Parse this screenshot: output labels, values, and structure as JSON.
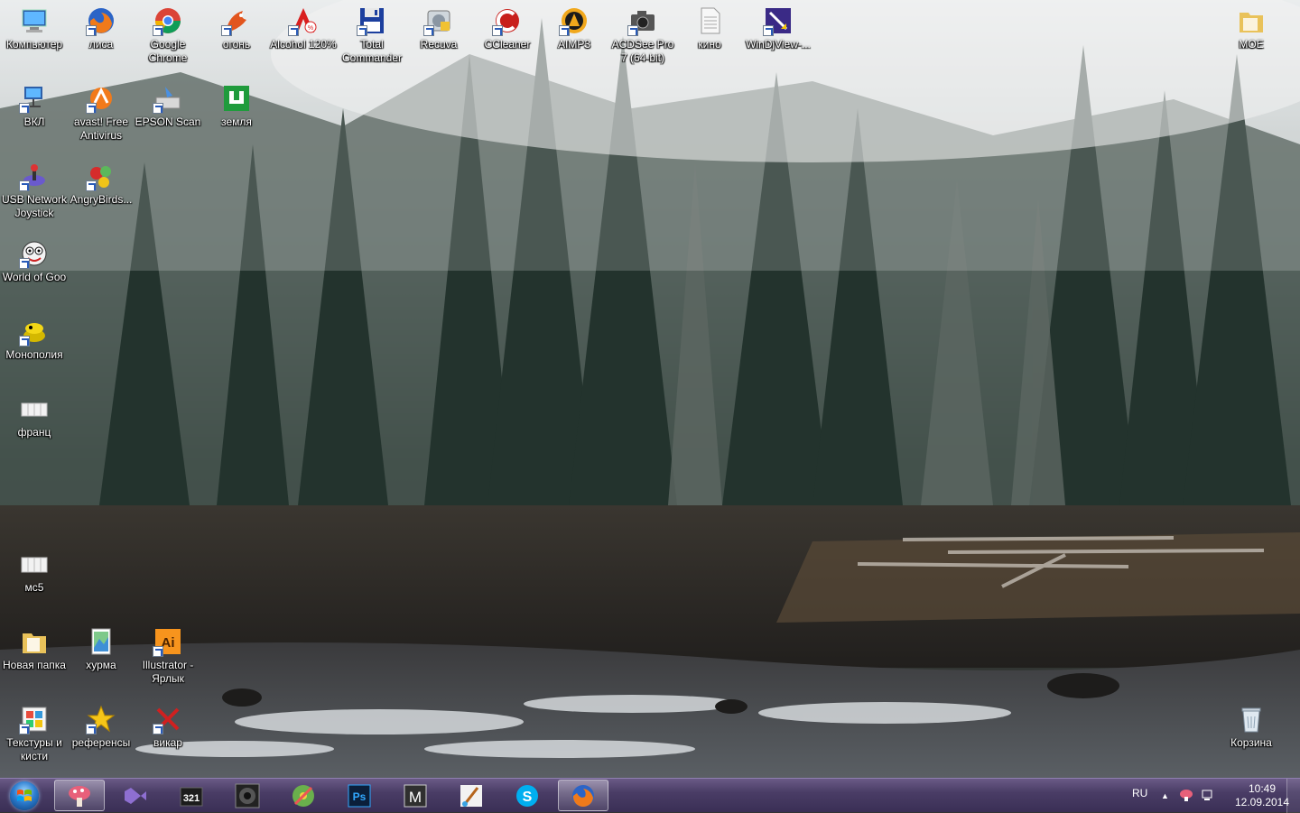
{
  "desktop": {
    "icons": [
      {
        "label": "Компьютер",
        "icon": "computer-icon"
      },
      {
        "label": "лиса",
        "icon": "firefox-icon"
      },
      {
        "label": "Google Chrome",
        "icon": "chrome-icon"
      },
      {
        "label": "огонь",
        "icon": "fire-fox-figure-icon"
      },
      {
        "label": "Alcohol 120%",
        "icon": "alcohol-icon"
      },
      {
        "label": "Total Commander",
        "icon": "floppy-disk-icon"
      },
      {
        "label": "Recuva",
        "icon": "recuva-icon"
      },
      {
        "label": "CCleaner",
        "icon": "ccleaner-icon"
      },
      {
        "label": "AIMP3",
        "icon": "aimp-icon"
      },
      {
        "label": "ACDSee Pro 7 (64-bit)",
        "icon": "camera-icon"
      },
      {
        "label": "кино",
        "icon": "text-document-icon"
      },
      {
        "label": "WinDjView-...",
        "icon": "windjview-icon"
      },
      {
        "label": "МОЕ",
        "icon": "folder-icon"
      },
      {
        "label": "ВКЛ",
        "icon": "network-icon"
      },
      {
        "label": "avast! Free Antivirus",
        "icon": "avast-icon"
      },
      {
        "label": "EPSON Scan",
        "icon": "scanner-icon"
      },
      {
        "label": "земля",
        "icon": "green-app-icon"
      },
      {
        "label": "USB Network Joystick",
        "icon": "joystick-icon"
      },
      {
        "label": "AngryBirds...",
        "icon": "angry-birds-icon"
      },
      {
        "label": "World of Goo",
        "icon": "goo-ball-icon"
      },
      {
        "label": "Монополия",
        "icon": "monopoly-icon"
      },
      {
        "label": "франц",
        "icon": "document-icon"
      },
      {
        "label": "мс5",
        "icon": "document-icon"
      },
      {
        "label": "Новая папка",
        "icon": "folder-icon"
      },
      {
        "label": "хурма",
        "icon": "image-file-icon"
      },
      {
        "label": "Illustrator - Ярлык",
        "icon": "illustrator-icon"
      },
      {
        "label": "Текстуры и кисти",
        "icon": "textures-icon"
      },
      {
        "label": "референсы",
        "icon": "star-icon"
      },
      {
        "label": "викар",
        "icon": "broken-shortcut-icon"
      },
      {
        "label": "Корзина",
        "icon": "recycle-bin-icon"
      }
    ]
  },
  "taskbar": {
    "start_label": "Start",
    "apps": [
      {
        "name": "mushroom-app",
        "icon": "mushroom-icon",
        "active": true
      },
      {
        "name": "visual-studio",
        "icon": "visual-studio-icon",
        "active": false
      },
      {
        "name": "media-player-classic",
        "icon": "mpc-icon",
        "active": false
      },
      {
        "name": "aimp",
        "icon": "speaker-icon",
        "active": false
      },
      {
        "name": "paint-app",
        "icon": "paint-disc-icon",
        "active": false
      },
      {
        "name": "photoshop",
        "icon": "photoshop-icon",
        "active": false
      },
      {
        "name": "m-app",
        "icon": "m-letter-icon",
        "active": false
      },
      {
        "name": "paint-brush-app",
        "icon": "paint-brush-icon",
        "active": false
      },
      {
        "name": "skype",
        "icon": "skype-icon",
        "active": false
      },
      {
        "name": "firefox",
        "icon": "firefox-icon",
        "active": true
      }
    ],
    "tray": {
      "language": "RU",
      "time": "10:49",
      "date": "12.09.2014"
    }
  },
  "colors": {
    "taskbar": "#4a3d66",
    "label_text": "#ffffff"
  }
}
